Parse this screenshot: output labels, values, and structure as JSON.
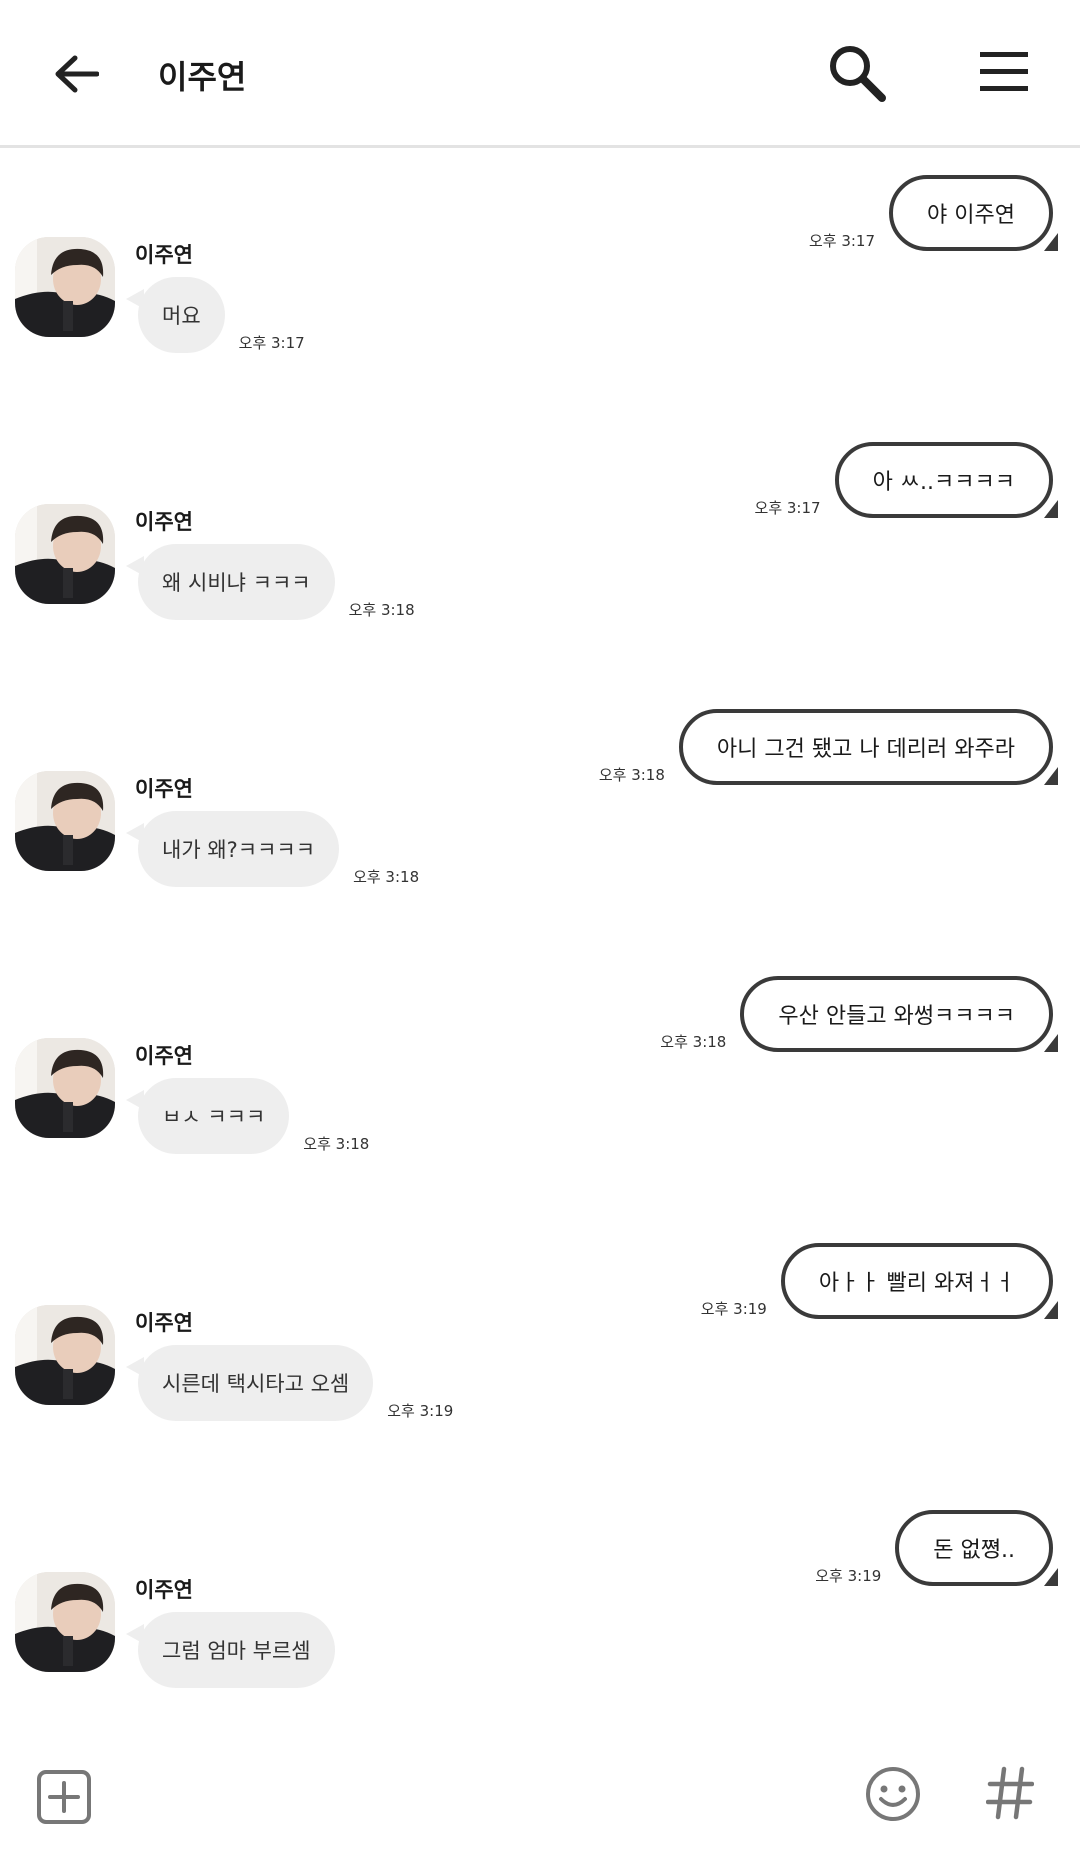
{
  "header": {
    "title": "이주연",
    "back_icon": "arrow-left-icon",
    "search_icon": "search-icon",
    "menu_icon": "hamburger-menu-icon"
  },
  "contact": {
    "name": "이주연"
  },
  "messages": [
    {
      "dir": "out",
      "text": "야 이주연",
      "time": "오후 3:17"
    },
    {
      "dir": "in",
      "sender": "이주연",
      "text": "머요",
      "time": "오후 3:17"
    },
    {
      "dir": "out",
      "text": "아 ㅆ..ㅋㅋㅋㅋ",
      "time": "오후 3:17"
    },
    {
      "dir": "in",
      "sender": "이주연",
      "text": "왜 시비냐 ㅋㅋㅋ",
      "time": "오후 3:18"
    },
    {
      "dir": "out",
      "text": "아니 그건 됐고 나 데리러 와주라",
      "time": "오후 3:18"
    },
    {
      "dir": "in",
      "sender": "이주연",
      "text": "내가 왜?ㅋㅋㅋㅋ",
      "time": "오후 3:18"
    },
    {
      "dir": "out",
      "text": "우산 안들고 와썽ㅋㅋㅋㅋ",
      "time": "오후 3:18"
    },
    {
      "dir": "in",
      "sender": "이주연",
      "text": "ㅂㅅ ㅋㅋㅋ",
      "time": "오후 3:18"
    },
    {
      "dir": "out",
      "text": "아ㅏㅏ 빨리 와져ㅓㅓ",
      "time": "오후 3:19"
    },
    {
      "dir": "in",
      "sender": "이주연",
      "text": "시른데 택시타고 오셈",
      "time": "오후 3:19"
    },
    {
      "dir": "out",
      "text": "돈 없쪙..",
      "time": "오후 3:19"
    },
    {
      "dir": "in",
      "sender": "이주연",
      "text": "그럼 엄마 부르셈",
      "time": ""
    }
  ],
  "bottom_bar": {
    "plus_icon": "plus-square-icon",
    "emoji_icon": "emoji-smile-icon",
    "hash_icon": "hashtag-icon"
  },
  "colors": {
    "out_border": "#3a3a3a",
    "in_bubble": "#eeeeee",
    "header_divider": "#e3e3e3",
    "icon": "#222222",
    "bottom_icon": "#777777"
  }
}
